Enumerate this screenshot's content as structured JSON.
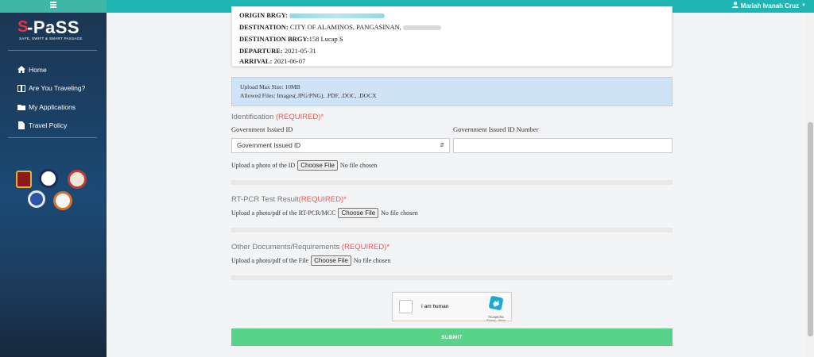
{
  "sidebar": {
    "logo": {
      "mark": "S",
      "text": "-PaSS",
      "tagline": "SAFE, SWIFT & SMART PASSAGE"
    },
    "items": [
      {
        "label": "Home",
        "icon": "home-icon"
      },
      {
        "label": "Are You Traveling?",
        "icon": "book-icon"
      },
      {
        "label": "My Applications",
        "icon": "folder-icon"
      },
      {
        "label": "Travel Policy",
        "icon": "document-icon"
      }
    ],
    "seals": [
      "pnp-seal-icon",
      "dict-seal-icon",
      "dilg-seal-icon",
      "ocd-seal-icon",
      "brgy-seal-icon"
    ]
  },
  "header": {
    "user_name": "Mariah Ivanah Cruz",
    "user_icon": "user-icon",
    "dropdown_icon": "caret-down-icon"
  },
  "summary": {
    "origin_brgy_label": "ORIGIN BRGY:",
    "destination_label": "DESTINATION:",
    "destination_value": "CITY OF ALAMINOS, PANGASINAN,",
    "destination_brgy_label": "DESTINATION BRGY:",
    "destination_brgy_value": "158 Lucap S",
    "departure_label": "DEPARTURE:",
    "departure_value": "2021-05-31",
    "arrival_label": "ARRIVAL:",
    "arrival_value": "2021-06-07"
  },
  "upload_info": {
    "max_size": "Upload Max Size: 10MB",
    "allowed": "Allowed Files: Images(.JPG/PNG), .PDF, .DOC, .DOCX"
  },
  "identification": {
    "title": "Identification",
    "required": "(REQUIRED)*",
    "id_label": "Government Issued ID",
    "id_number_label": "Government Issued ID Number",
    "select_value": "Government Issued ID",
    "upload_label": "Upload a photo of the ID",
    "button": "Choose File",
    "file_status": "No file chosen"
  },
  "rtpcr": {
    "title": "RT-PCR Test Result",
    "required": "(REQUIRED)*",
    "upload_label": "Upload a photo/pdf of the RT-PCR/MCC",
    "button": "Choose File",
    "file_status": "No file chosen"
  },
  "other_docs": {
    "title": "Other Documents/Requirements",
    "required": "(REQUIRED)*",
    "upload_label": "Upload a photo/pdf of the File",
    "button": "Choose File",
    "file_status": "No file chosen"
  },
  "captcha": {
    "label": "I am human",
    "brand": "hCaptcha",
    "links": "Privacy - Terms",
    "logo_icon": "hcaptcha-logo-icon"
  },
  "submit_label": "SUBMIT",
  "colors": {
    "topbar": "#1fb5b3",
    "submit": "#57d38a",
    "required": "#e65a55",
    "info_bg": "#cfe3f7"
  }
}
